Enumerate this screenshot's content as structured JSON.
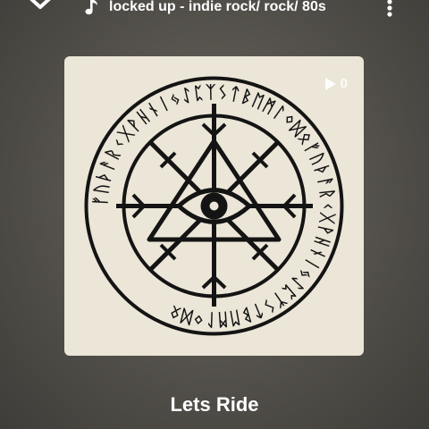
{
  "header": {
    "playlist_title": "locked up - indie rock/ rock/ 80s"
  },
  "artwork": {
    "play_count": "0",
    "ring_runes": "ᚠᚢᚦᚨᚱᚲᚷᚹᚺᚾᛁᛃᛇᛈᛉᛊᛏᛒᛖᛗᛚᛜᛞᛟᚠᚢᚦᚨᚱᚲᚷᚹᚺᚾᛁᛃᛇᛈᛉᛊᛏᛒᛖᛗᛚᛜᛞᛟ"
  },
  "track": {
    "title": "Lets Ride"
  },
  "icons": {
    "collapse": "chevron-down-icon",
    "note": "music-note-icon",
    "more": "more-vertical-icon",
    "play": "play-icon"
  }
}
